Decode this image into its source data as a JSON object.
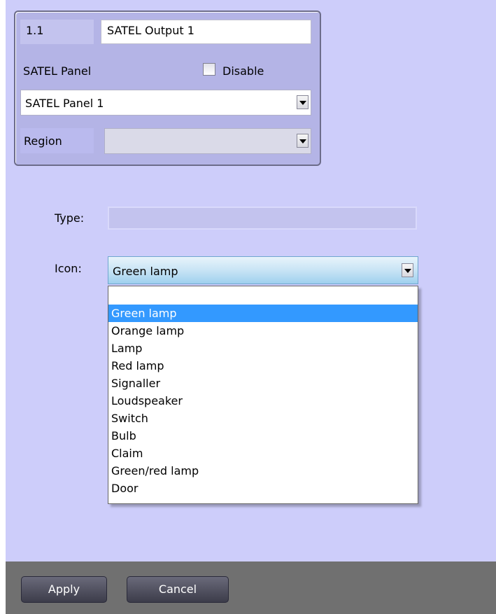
{
  "object": {
    "id": "1.1",
    "name": "SATEL Output 1",
    "panel_label": "SATEL Panel",
    "disable_label": "Disable",
    "disable_checked": false,
    "panel_value": "SATEL Panel 1",
    "region_label": "Region",
    "region_value": ""
  },
  "settings": {
    "type_label": "Type:",
    "type_value": "",
    "icon_label": "Icon:",
    "icon_value": "Green lamp"
  },
  "dropdown": {
    "options": [
      "Green lamp",
      "Orange lamp",
      "Lamp",
      "Red lamp",
      "Signaller",
      "Loudspeaker",
      "Switch",
      "Bulb",
      "Claim",
      "Green/red lamp",
      "Door"
    ],
    "selected": "Green lamp"
  },
  "footer": {
    "apply_label": "Apply",
    "cancel_label": "Cancel"
  },
  "colors": {
    "panel_background": "#cdcdfa",
    "selection": "#3399ff",
    "footer": "#707070"
  },
  "icons": {
    "checkbox": "checkbox-icon",
    "dropdown_arrow": "chevron-down-icon"
  }
}
